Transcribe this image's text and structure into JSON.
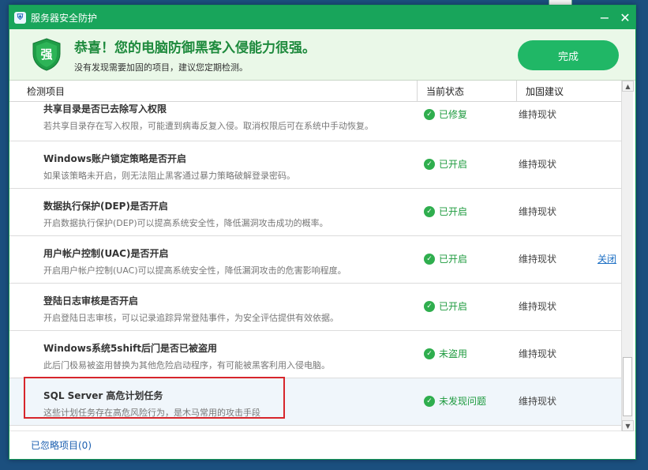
{
  "window": {
    "title": "服务器安全防护",
    "icon": "shield-icon"
  },
  "header": {
    "shield_char": "强",
    "title": "恭喜！您的电脑防御黑客入侵能力很强。",
    "subtitle": "没有发现需要加固的项目，建议您定期检测。",
    "done_label": "完成"
  },
  "columns": {
    "item": "检测项目",
    "status": "当前状态",
    "advice": "加固建议"
  },
  "rows": [
    {
      "title": "共享目录是否已去除写入权限",
      "desc": "若共享目录存在写入权限，可能遭到病毒反复入侵。取消权限后可在系统中手动恢复。",
      "status": "已修复",
      "advice": "维持现状",
      "action": ""
    },
    {
      "title": "Windows账户锁定策略是否开启",
      "desc": "如果该策略未开启，则无法阻止黑客通过暴力策略破解登录密码。",
      "status": "已开启",
      "advice": "维持现状",
      "action": ""
    },
    {
      "title": "数据执行保护(DEP)是否开启",
      "desc": "开启数据执行保护(DEP)可以提高系统安全性，降低漏洞攻击成功的概率。",
      "status": "已开启",
      "advice": "维持现状",
      "action": ""
    },
    {
      "title": "用户帐户控制(UAC)是否开启",
      "desc": "开启用户帐户控制(UAC)可以提高系统安全性，降低漏洞攻击的危害影响程度。",
      "status": "已开启",
      "advice": "维持现状",
      "action": "关闭"
    },
    {
      "title": "登陆日志审核是否开启",
      "desc": "开启登陆日志审核，可以记录追踪异常登陆事件，为安全评估提供有效依据。",
      "status": "已开启",
      "advice": "维持现状",
      "action": ""
    },
    {
      "title": "Windows系统5shift后门是否已被盗用",
      "desc": "此后门极易被盗用替换为其他危险启动程序，有可能被黑客利用入侵电脑。",
      "status": "未盗用",
      "advice": "维持现状",
      "action": ""
    },
    {
      "title": "SQL Server 高危计划任务",
      "desc": "这些计划任务存在高危风险行为，是木马常用的攻击手段",
      "status": "未发现问题",
      "advice": "维持现状",
      "action": ""
    }
  ],
  "footer": {
    "ignored_label": "已忽略项目(0)"
  },
  "colors": {
    "titlebar": "#18a55b",
    "header_bg": "#eaf8e8",
    "done_button": "#20b766",
    "status_green": "#1d9a3e",
    "highlight_red": "#d7262b",
    "link_blue": "#1c6fc4"
  }
}
